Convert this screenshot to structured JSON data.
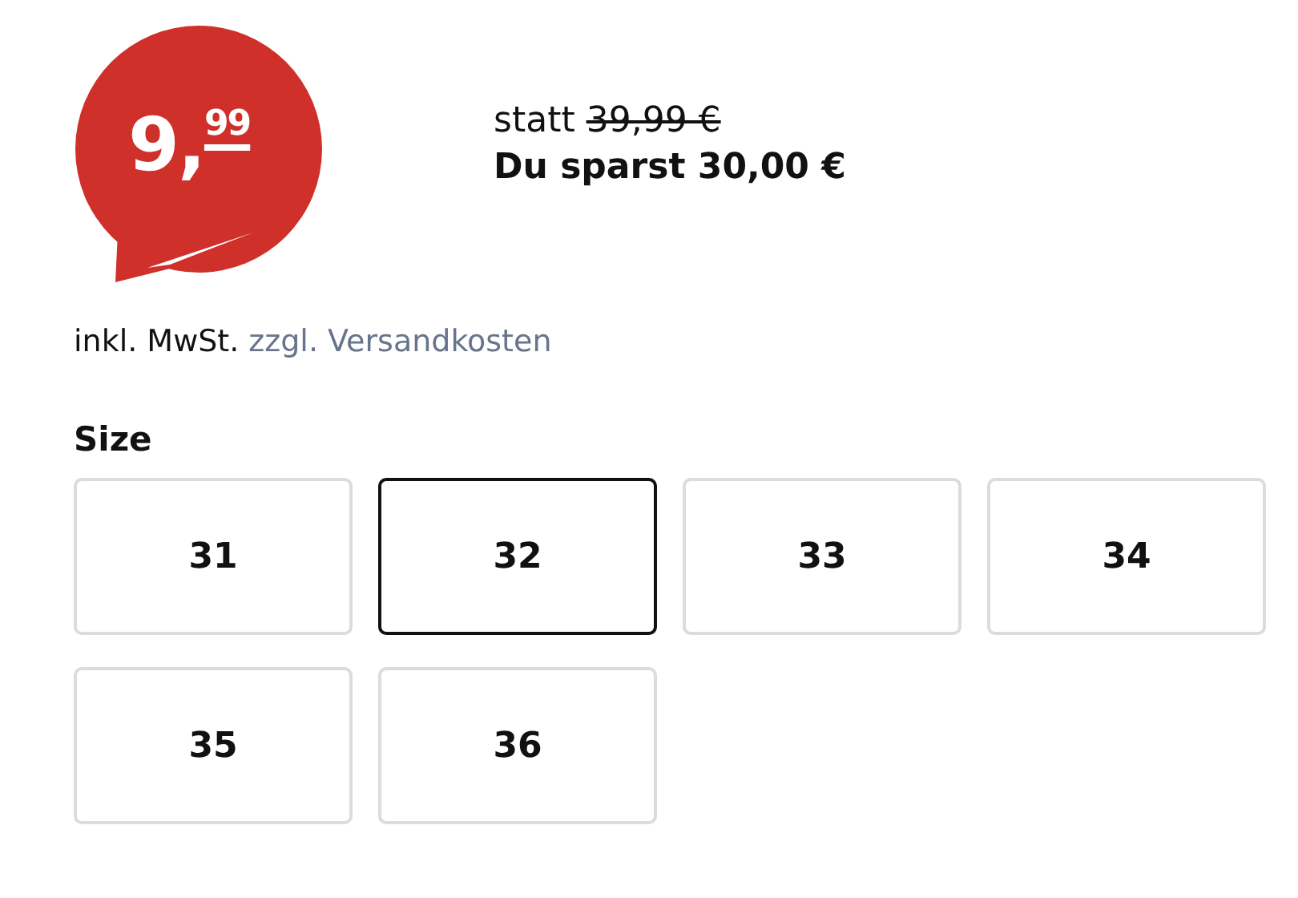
{
  "price_badge": {
    "whole": "9,",
    "cents": "99"
  },
  "comparison": {
    "prefix": "statt",
    "old_price": "39,99 €",
    "savings": "Du sparst 30,00 €"
  },
  "tax_note": {
    "text": "inkl. MwSt.",
    "link": "zzgl. Versandkosten"
  },
  "size": {
    "label": "Size",
    "options": [
      {
        "label": "31",
        "selected": false
      },
      {
        "label": "32",
        "selected": true
      },
      {
        "label": "33",
        "selected": false
      },
      {
        "label": "34",
        "selected": false
      },
      {
        "label": "35",
        "selected": false
      },
      {
        "label": "36",
        "selected": false
      }
    ]
  }
}
